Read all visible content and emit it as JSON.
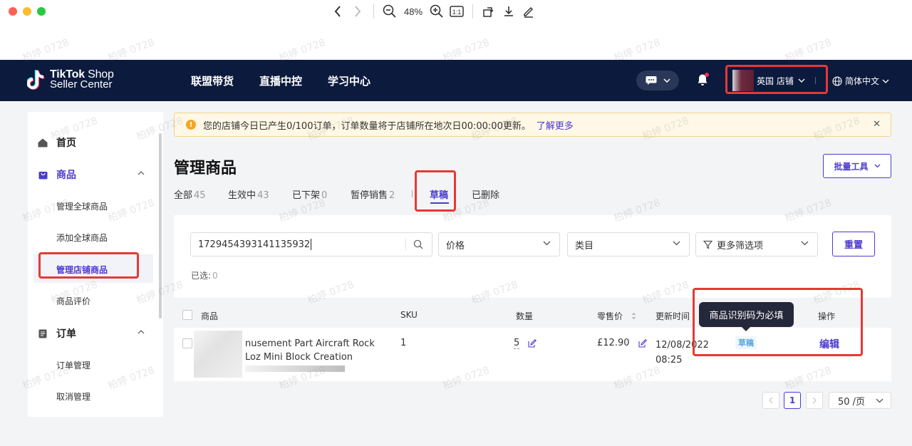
{
  "viewer": {
    "zoom": "48%",
    "icons": [
      "back-icon",
      "forward-icon",
      "zoom-out-icon",
      "zoom-in-icon",
      "actual-size-icon",
      "rotate-icon",
      "download-icon",
      "markup-icon"
    ]
  },
  "nav": {
    "logo_line1": "TikTok",
    "logo_line1b": " Shop",
    "logo_line2": "Seller Center",
    "links": [
      "联盟带货",
      "直播中控",
      "学习中心"
    ],
    "store": "英国 店铺",
    "language": "简体中文"
  },
  "sidebar": {
    "home": "首页",
    "products": "商品",
    "product_items": [
      "管理全球商品",
      "添加全球商品",
      "管理店铺商品",
      "商品评价"
    ],
    "orders": "订单",
    "order_items": [
      "订单管理",
      "取消管理"
    ]
  },
  "banner": {
    "text": "您的店铺今日已产生0/100订单，订单数量将于店铺所在地次日00:00:00更新。",
    "link": "了解更多"
  },
  "page": {
    "title": "管理商品",
    "batch_tools": "批量工具"
  },
  "tabs": [
    {
      "label": "全部",
      "count": "45"
    },
    {
      "label": "生效中",
      "count": "43"
    },
    {
      "label": "已下架",
      "count": "0"
    },
    {
      "label": "暂停销售",
      "count": "2"
    },
    {
      "label": "草稿",
      "count": ""
    },
    {
      "label": "已删除",
      "count": ""
    }
  ],
  "filters": {
    "search_value": "1729454393141135932",
    "price": "价格",
    "category": "类目",
    "more": "更多筛选项",
    "reset": "重置",
    "selected_label": "已选:",
    "selected_count": "0"
  },
  "table": {
    "headers": [
      "商品",
      "SKU",
      "数量",
      "零售价",
      "更新时间",
      "操作"
    ],
    "row": {
      "name_line1": "nusement Part Aircraft Rock",
      "name_line2": "Loz Mini Block Creation",
      "sku": "1",
      "quantity": "5",
      "price": "£12.90",
      "updated_date": "12/08/2022",
      "updated_time": "08:25",
      "status": "草稿",
      "action": "编辑"
    }
  },
  "tooltip": "商品识别码为必填",
  "pagination": {
    "current": "1",
    "page_size": "50 /页"
  },
  "watermark": "柏婷 0728",
  "colors": {
    "nav_bg": "#0c1a3d",
    "accent": "#4c3bcf",
    "highlight_box": "#e53935"
  }
}
